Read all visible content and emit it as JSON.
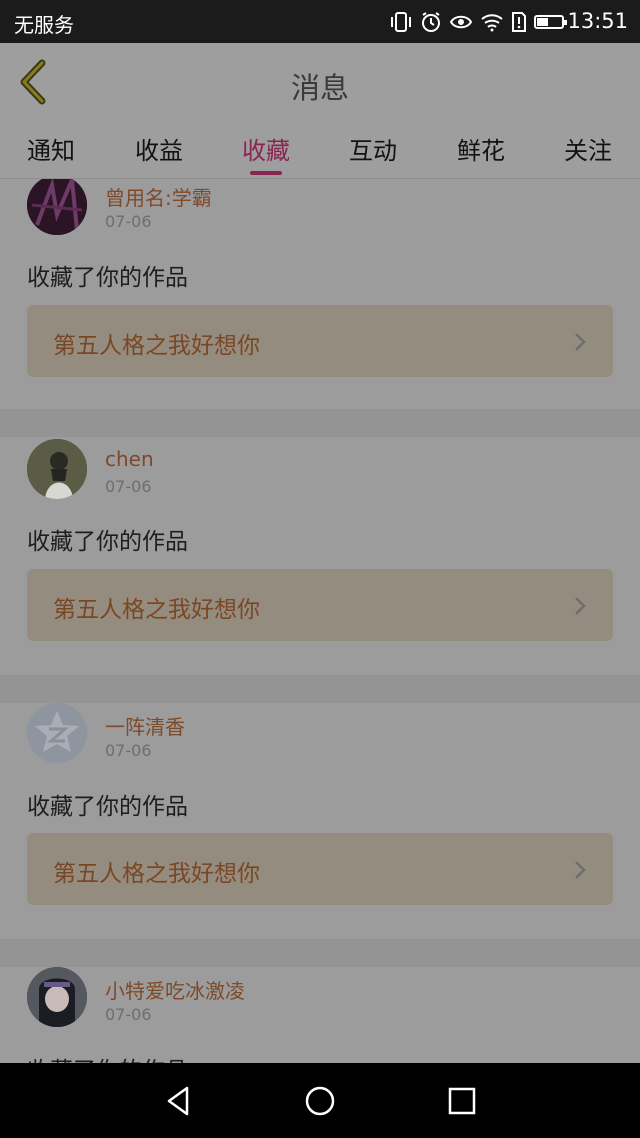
{
  "status_bar": {
    "carrier": "无服务",
    "time": "13:51",
    "battery_level": 0.45,
    "icons": [
      "vibrate-icon",
      "alarm-icon",
      "eye-icon",
      "wifi-icon",
      "sim-alert-icon",
      "battery-icon"
    ]
  },
  "header": {
    "title": "消息",
    "back_icon": "chevron-left-icon"
  },
  "tabs": [
    {
      "label": "通知",
      "active": false
    },
    {
      "label": "收益",
      "active": false
    },
    {
      "label": "收藏",
      "active": true
    },
    {
      "label": "互动",
      "active": false
    },
    {
      "label": "鲜花",
      "active": false
    },
    {
      "label": "关注",
      "active": false
    }
  ],
  "colors": {
    "accent": "#8a2552",
    "username": "#7e4a2a",
    "overlay_background": "#9c9c9c"
  },
  "items": [
    {
      "username": "曾用名:学霸",
      "date": "07-06",
      "action": "收藏了你的作品",
      "work_title": "第五人格之我好想你"
    },
    {
      "username": "chen",
      "date": "07-06",
      "action": "收藏了你的作品",
      "work_title": "第五人格之我好想你"
    },
    {
      "username": "一阵清香",
      "date": "07-06",
      "action": "收藏了你的作品",
      "work_title": "第五人格之我好想你"
    },
    {
      "username": "小特爱吃冰激凌",
      "date": "07-06",
      "action": "收藏了你的作品",
      "work_title": ""
    }
  ],
  "nav_bar": {
    "icons": [
      "back-triangle-icon",
      "home-circle-icon",
      "recents-square-icon"
    ]
  }
}
